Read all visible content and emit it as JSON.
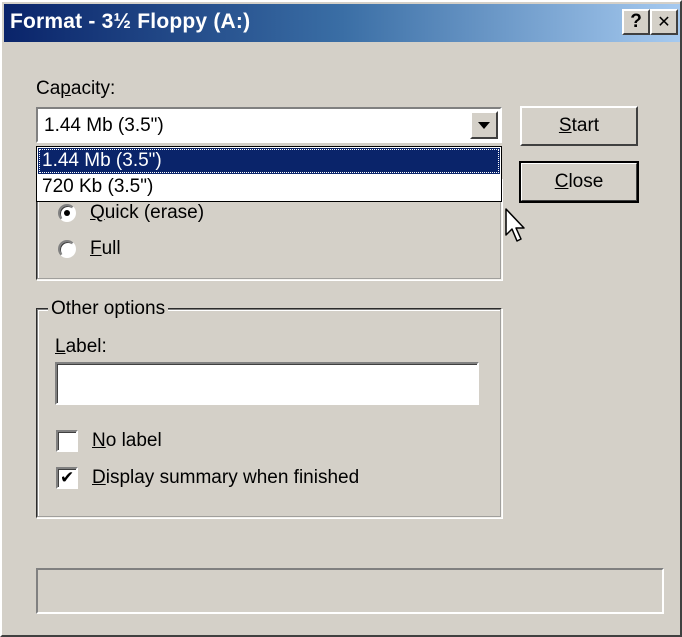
{
  "window": {
    "title": "Format - 3½ Floppy (A:)",
    "help_button": "?",
    "close_button": "✕"
  },
  "capacity": {
    "label_pre": "Ca",
    "label_mn": "p",
    "label_post": "acity:",
    "selected": "1.44 Mb (3.5\")",
    "options": [
      "1.44 Mb (3.5\")",
      "720 Kb (3.5\")"
    ],
    "highlighted_index": 0
  },
  "buttons": {
    "start_mn": "S",
    "start_rest": "tart",
    "close_mn": "C",
    "close_rest": "lose"
  },
  "format_type": {
    "quick_mn": "Q",
    "quick_rest": "uick (erase)",
    "full_mn": "F",
    "full_rest": "ull",
    "selected": "quick"
  },
  "other_options": {
    "caption": "Other options",
    "label_mn": "L",
    "label_rest": "abel:",
    "label_value": "",
    "no_label_mn": "N",
    "no_label_rest": "o label",
    "no_label_checked": false,
    "display_summary_mn": "D",
    "display_summary_rest": "isplay summary when finished",
    "display_summary_checked": true
  },
  "colors": {
    "face": "#d4d0c8",
    "title_start": "#0a246a",
    "title_end": "#a6caf0",
    "highlight": "#0a246a"
  }
}
